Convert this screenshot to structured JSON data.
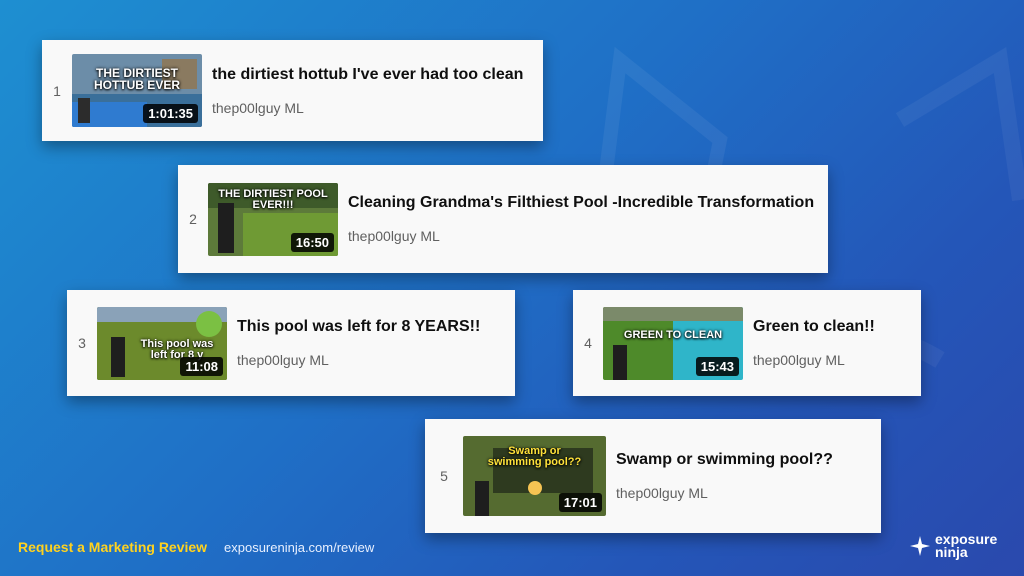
{
  "videos": [
    {
      "rank": "1",
      "title": "the dirtiest hottub I've ever had too clean",
      "channel": "thep00lguy ML",
      "duration": "1:01:35",
      "thumb_text": "THE DIRTIEST HOTTUB EVER"
    },
    {
      "rank": "2",
      "title": "Cleaning Grandma's Filthiest Pool -Incredible Transformation",
      "channel": "thep00lguy ML",
      "duration": "16:50",
      "thumb_text": "THE DIRTIEST POOL EVER!!!"
    },
    {
      "rank": "3",
      "title": "This pool was left for 8 YEARS!!",
      "channel": "thep00lguy ML",
      "duration": "11:08",
      "thumb_text": "This pool was left for 8 y"
    },
    {
      "rank": "4",
      "title": "Green to clean!!",
      "channel": "thep00lguy ML",
      "duration": "15:43",
      "thumb_text": "GREEN TO CLEAN"
    },
    {
      "rank": "5",
      "title": "Swamp or swimming pool??",
      "channel": "thep00lguy ML",
      "duration": "17:01",
      "thumb_text": "Swamp or swimming pool??"
    }
  ],
  "footer": {
    "cta": "Request a Marketing Review",
    "url": "exposureninja.com/review"
  },
  "brand": {
    "line1": "exposure",
    "line2": "ninja"
  },
  "colors": {
    "accent": "#ffd21f",
    "card": "#f9f9f9"
  }
}
